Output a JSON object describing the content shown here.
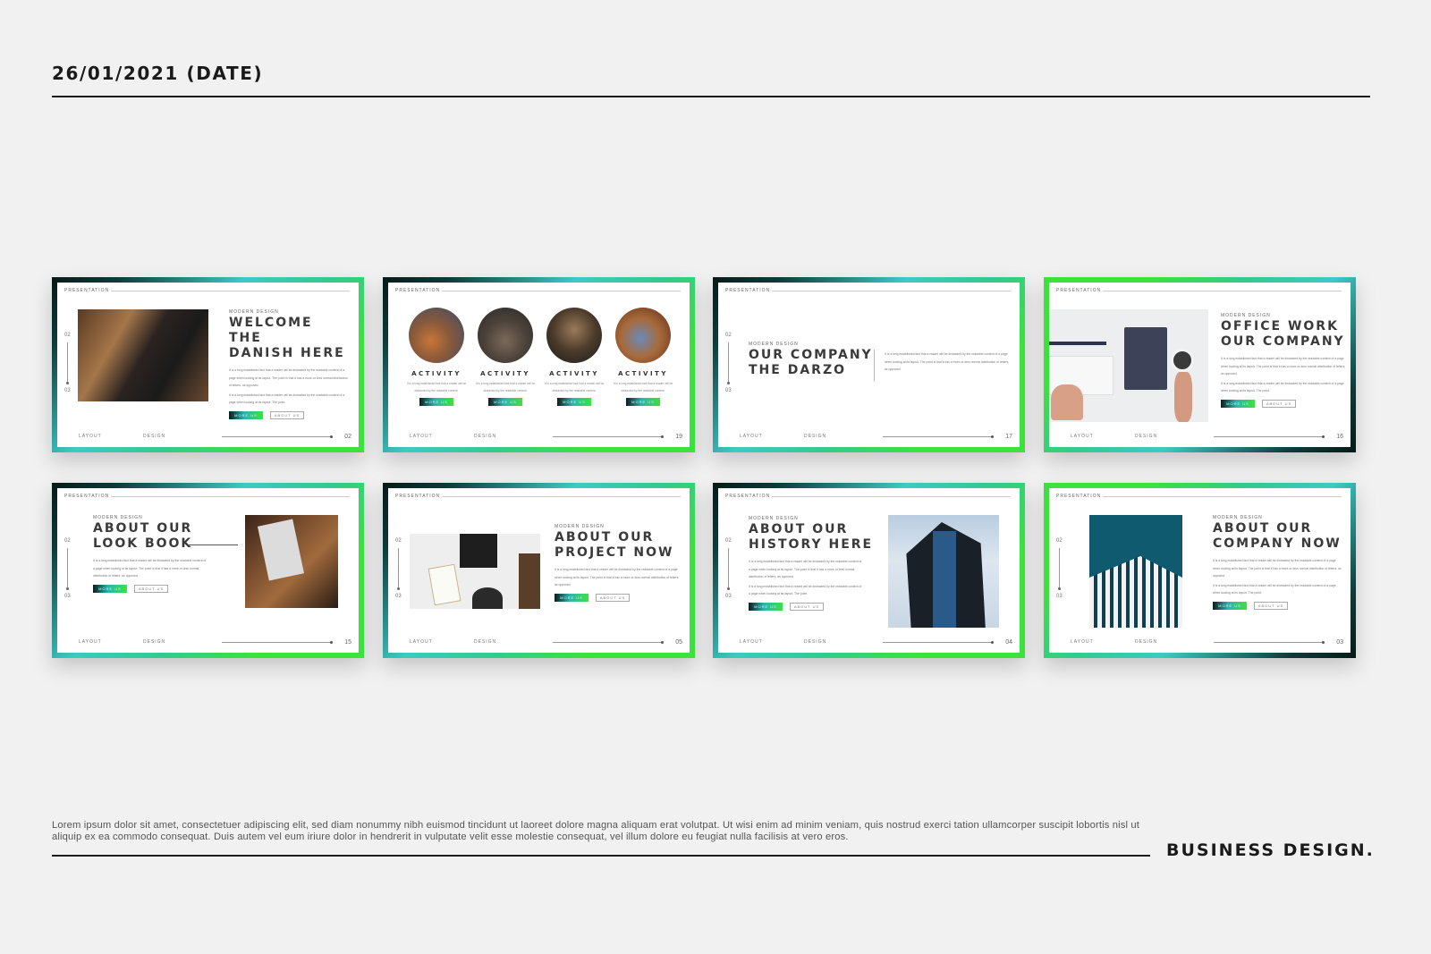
{
  "header": {
    "date": "26/01/2021 (DATE)"
  },
  "common": {
    "presentation_label": "PRESENTATION",
    "layout_label": "LAYOUT",
    "design_label": "DESIGN",
    "step_from": "02",
    "step_to": "03",
    "subtitle": "MODERN DESIGN",
    "more_button": "MORE US",
    "about_button": "ABOUT US",
    "para_long": "It is a long established fact that a reader will be distracted by the readable content of a page when looking at its layout. The point is that it has a more-or-less normal distribution of letters, as opposed.",
    "para_short": "It is a long established fact that a reader will be distracted by the readable content of a page when looking at its layout. The point.",
    "activity_para": "It is a long established fact that a reader will be distracted by the readable content."
  },
  "slides": [
    {
      "title_line1": "WELCOME THE",
      "title_line2": "DANISH HERE",
      "page": "02",
      "image": "man-reading-book-photo"
    },
    {
      "activity_title": "ACTIVITY",
      "page": "19",
      "images": [
        "office-lounge-photo",
        "team-meeting-photo",
        "women-laptop-photo",
        "laptop-desk-photo"
      ]
    },
    {
      "title_line1": "OUR COMPANY",
      "title_line2": "THE DARZO",
      "page": "17"
    },
    {
      "title_line1": "OFFICE WORK",
      "title_line2": "OUR COMPANY",
      "page": "16",
      "image": "desk-notebook-coffee-photo"
    },
    {
      "title_line1": "ABOUT OUR",
      "title_line2": "LOOK BOOK",
      "page": "15",
      "image": "foundr-magazine-photo"
    },
    {
      "title_line1": "ABOUT OUR",
      "title_line2": "PROJECT NOW",
      "page": "05",
      "image": "laptop-workspace-photo"
    },
    {
      "title_line1": "ABOUT OUR",
      "title_line2": "HISTORY HERE",
      "page": "04",
      "image": "glass-tower-photo"
    },
    {
      "title_line1": "ABOUT OUR",
      "title_line2": "COMPANY NOW",
      "page": "03",
      "image": "white-building-photo"
    }
  ],
  "footer": {
    "body": "Lorem ipsum dolor sit amet, consectetuer adipiscing elit, sed diam nonummy nibh euismod tincidunt ut laoreet dolore magna aliquam erat volutpat. Ut wisi enim ad minim veniam, quis nostrud exerci tation ullamcorper suscipit lobortis nisl ut aliquip ex ea commodo consequat. Duis autem vel eum iriure dolor in hendrerit in vulputate velit esse molestie consequat, vel illum dolore eu feugiat nulla facilisis at vero eros.",
    "brand": "BUSINESS DESIGN."
  },
  "colors": {
    "gradient_dark": "#061a16",
    "gradient_teal": "#3ec9c4",
    "gradient_green": "#3ce23c",
    "background": "#f1f1f1",
    "title_text": "#3a3a3a"
  }
}
